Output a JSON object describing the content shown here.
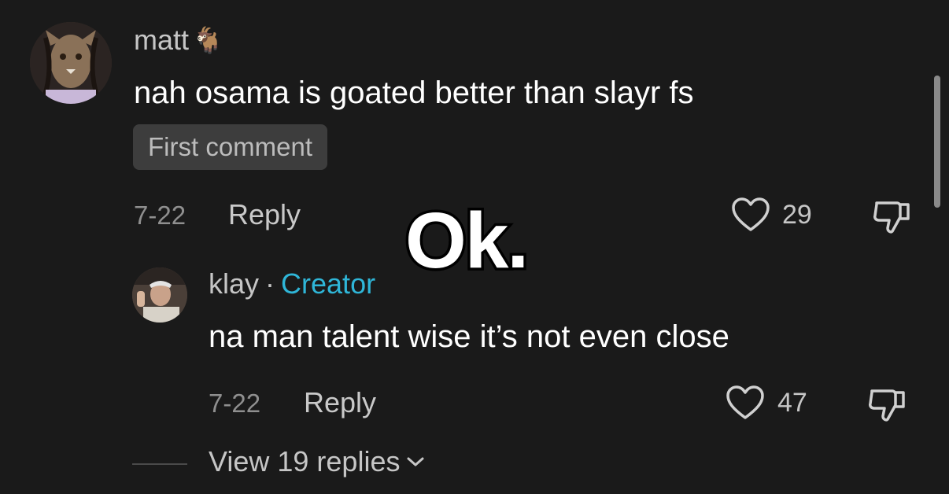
{
  "comment": {
    "username": "matt",
    "username_emoji": "🐐",
    "text": "nah osama is goated better than slayr fs",
    "badge": "First comment",
    "date": "7-22",
    "reply_label": "Reply",
    "like_count": "29"
  },
  "reply": {
    "username": "klay",
    "separator": "·",
    "role": "Creator",
    "text": "na man talent wise it’s not even close",
    "date": "7-22",
    "reply_label": "Reply",
    "like_count": "47"
  },
  "view_replies": {
    "label": "View 19 replies"
  },
  "overlay": {
    "text": "Ok."
  },
  "colors": {
    "background": "#1a1a1a",
    "creator_accent": "#2fb6d8",
    "badge_bg": "#3d3d3d"
  },
  "icons": [
    "heart-icon",
    "dislike-icon",
    "chevron-down-icon"
  ]
}
